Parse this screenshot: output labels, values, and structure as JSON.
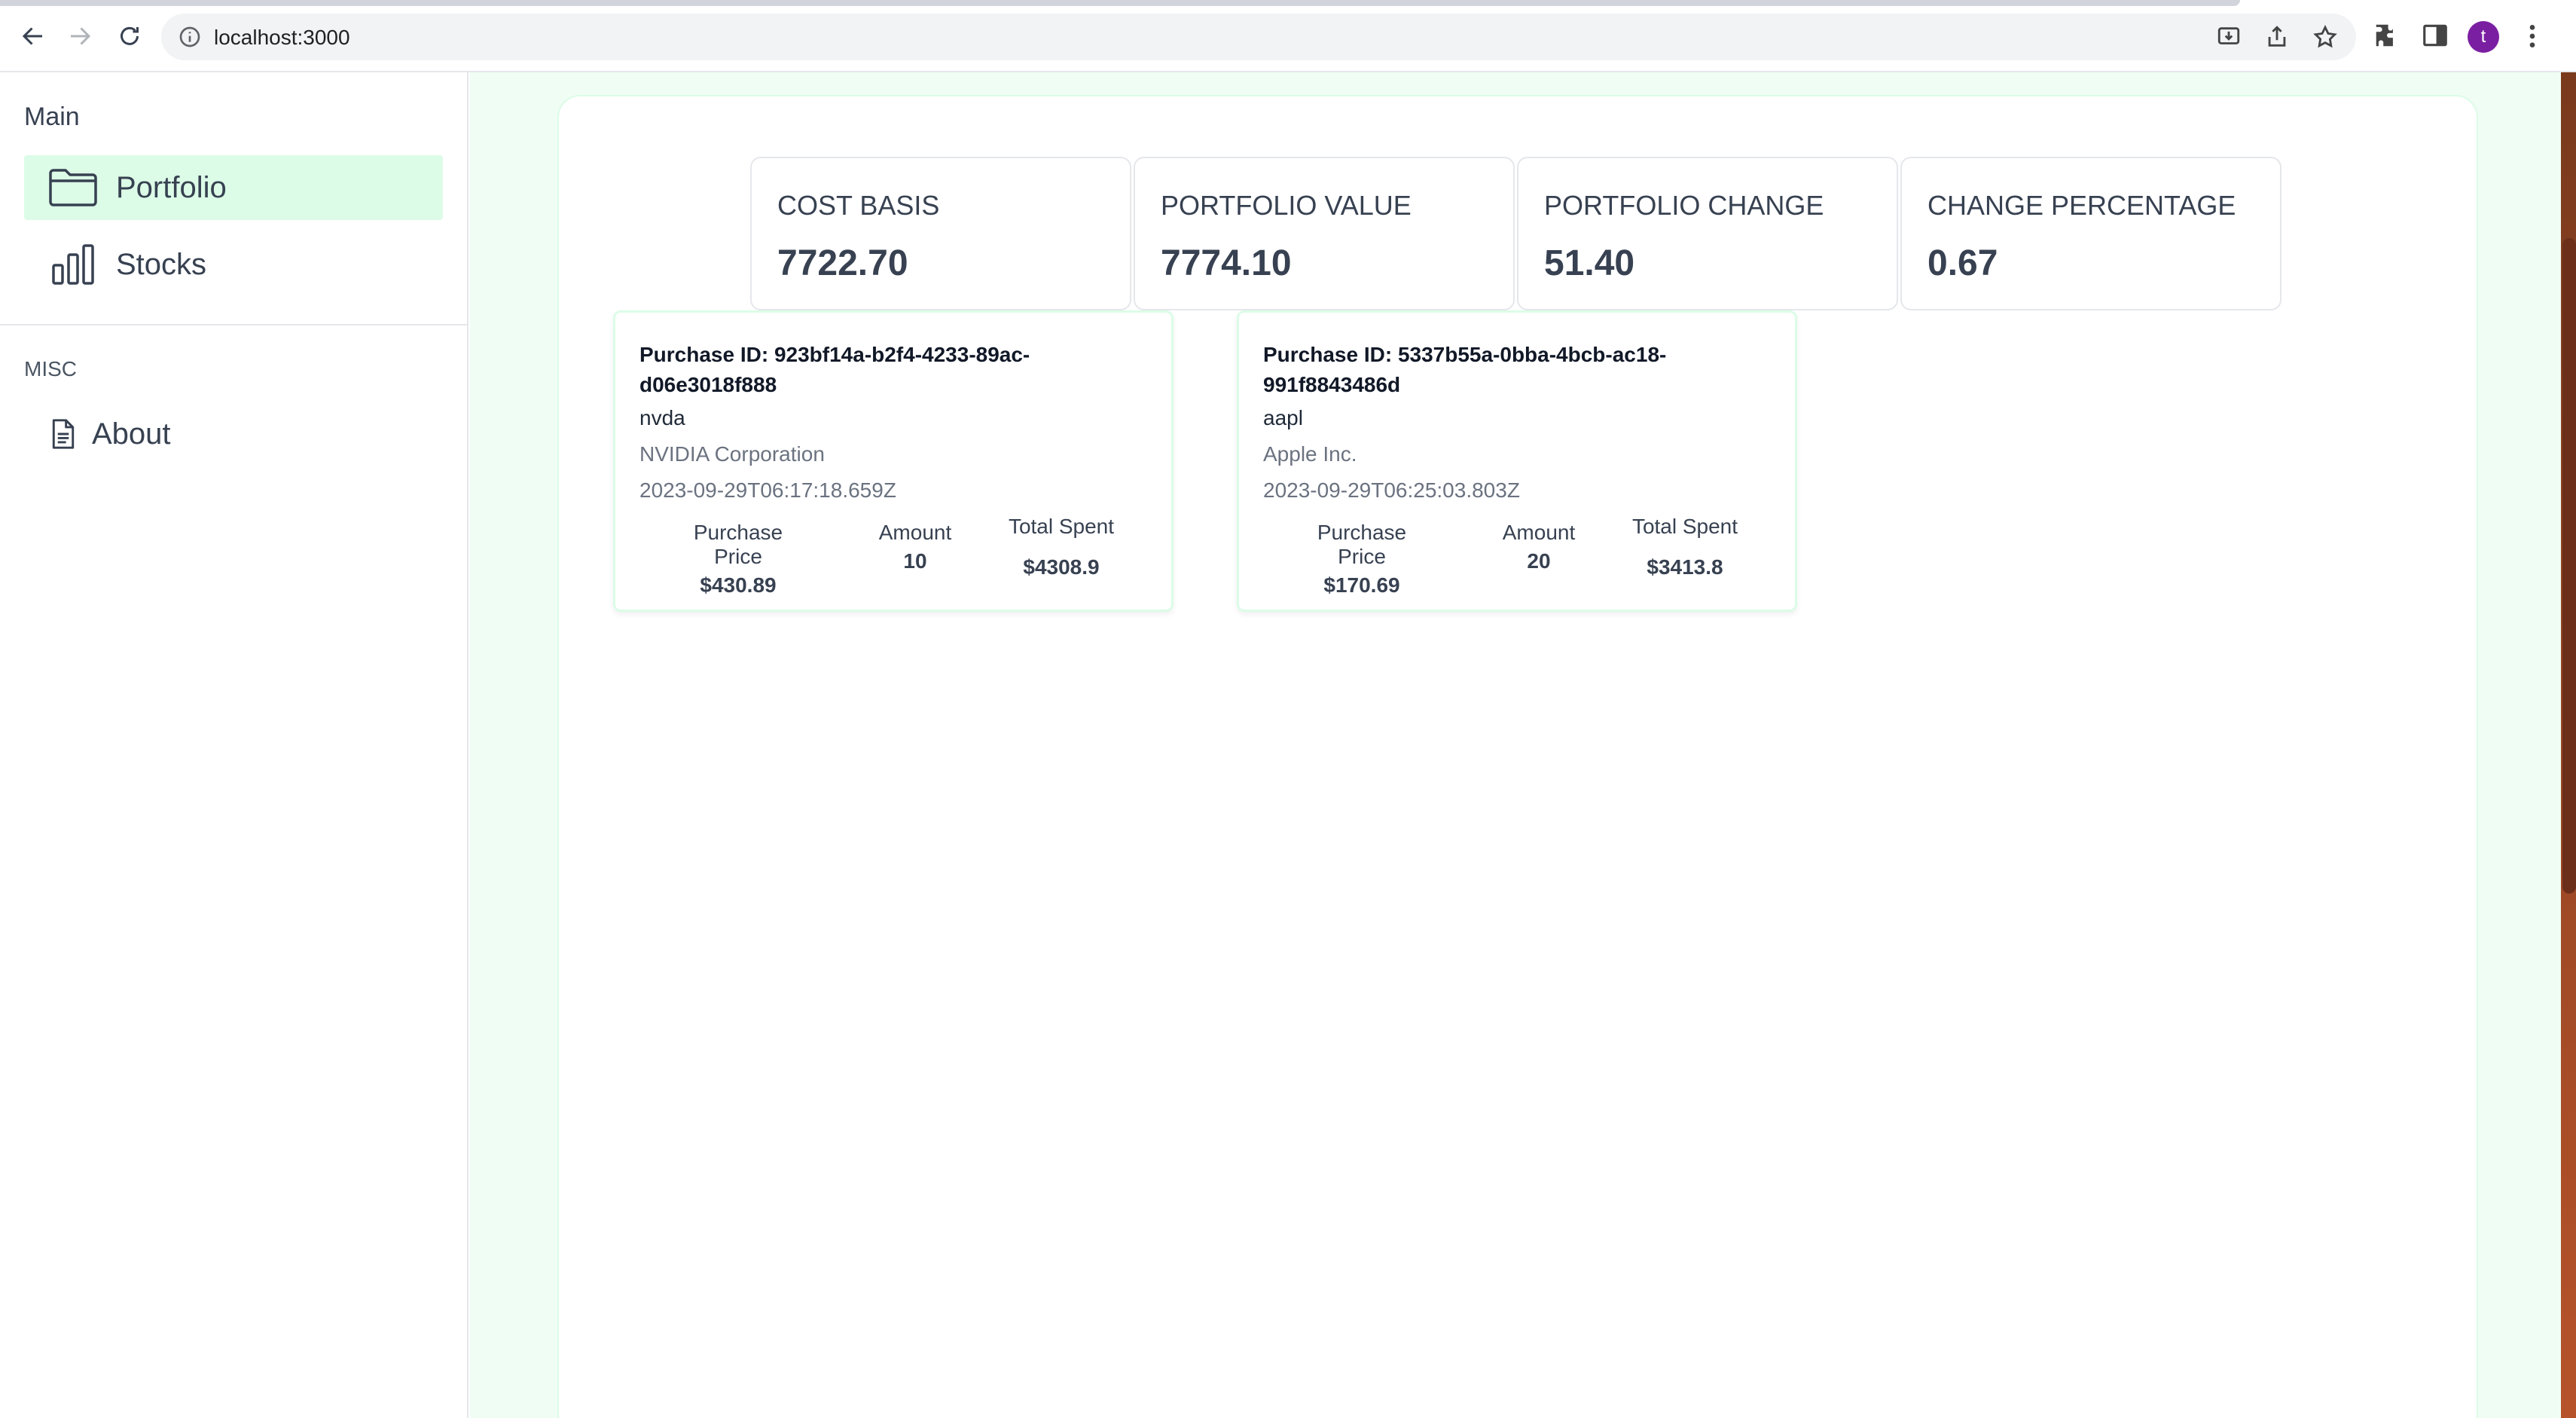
{
  "browser": {
    "url": "localhost:3000",
    "avatar_letter": "t"
  },
  "sidebar": {
    "main_heading": "Main",
    "items": [
      {
        "label": "Portfolio",
        "icon": "folder-icon",
        "active": true
      },
      {
        "label": "Stocks",
        "icon": "bar-chart-icon",
        "active": false
      }
    ],
    "misc_heading": "MISC",
    "misc_items": [
      {
        "label": "About",
        "icon": "document-icon"
      }
    ]
  },
  "stats": [
    {
      "title": "COST BASIS",
      "value": "7722.70"
    },
    {
      "title": "PORTFOLIO VALUE",
      "value": "7774.10"
    },
    {
      "title": "PORTFOLIO CHANGE",
      "value": "51.40"
    },
    {
      "title": "CHANGE PERCENTAGE",
      "value": "0.67"
    }
  ],
  "purchases": [
    {
      "purchase_id": "Purchase ID: 923bf14a-b2f4-4233-89ac-d06e3018f888",
      "symbol": "nvda",
      "company": "NVIDIA Corporation",
      "date": "2023-09-29T06:17:18.659Z",
      "price_label": "Purchase Price",
      "price": "$430.89",
      "amount_label": "Amount",
      "amount": "10",
      "total_label": "Total Spent",
      "total": "$4308.9"
    },
    {
      "purchase_id": "Purchase ID: 5337b55a-0bba-4bcb-ac18-991f8843486d",
      "symbol": "aapl",
      "company": "Apple Inc.",
      "date": "2023-09-29T06:25:03.803Z",
      "price_label": "Purchase Price",
      "price": "$170.69",
      "amount_label": "Amount",
      "amount": "20",
      "total_label": "Total Spent",
      "total": "$3413.8"
    }
  ],
  "colors": {
    "accent_light": "#dcfce7",
    "background": "#f0fdf4",
    "avatar": "#7b1fa2"
  }
}
